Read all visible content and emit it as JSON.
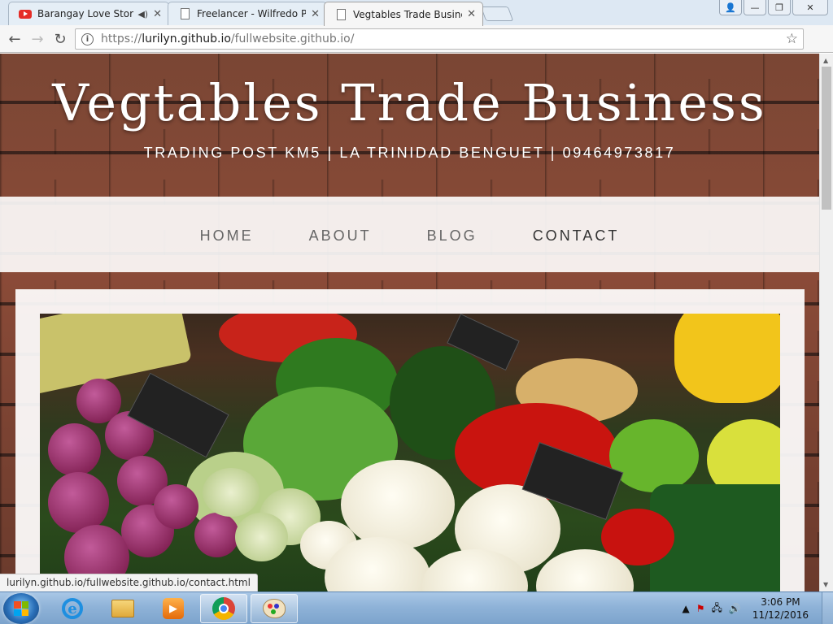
{
  "browser": {
    "tabs": [
      {
        "title": "Barangay Love Stories",
        "favicon": "youtube-icon",
        "audio": true
      },
      {
        "title": "Freelancer - Wilfredo P. P",
        "favicon": "page-icon"
      },
      {
        "title": "Vegtables Trade Busines",
        "favicon": "page-icon",
        "active": true
      }
    ],
    "url": {
      "scheme": "https://",
      "host": "lurilyn.github.io",
      "path": "/fullwebsite.github.io/"
    },
    "status_url": "lurilyn.github.io/fullwebsite.github.io/contact.html"
  },
  "page": {
    "title": "Vegtables Trade Business",
    "subtitle": "TRADING POST KM5 | LA TRINIDAD BENGUET | 09464973817",
    "nav": [
      "HOME",
      "ABOUT",
      "BLOG",
      "CONTACT"
    ],
    "nav_hovered": "CONTACT",
    "hero_image": "vegetable market stall (onions, cauliflower, lettuce, peppers, cucumbers, bananas)"
  },
  "taskbar": {
    "apps": [
      "start",
      "internet-explorer",
      "file-explorer",
      "media-player",
      "chrome",
      "paint"
    ],
    "clock_time": "3:06 PM",
    "clock_date": "11/12/2016"
  },
  "colors": {
    "brick": "#7a4634",
    "nav_band": "#ffffff",
    "accent_red": "#e52d27"
  }
}
